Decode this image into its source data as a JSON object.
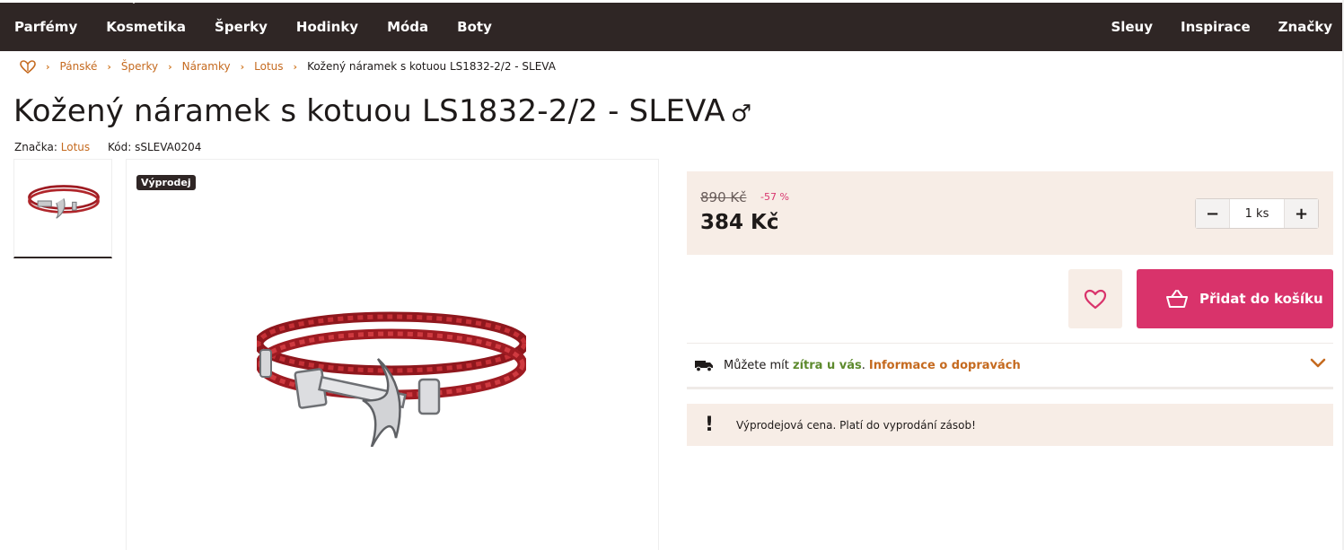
{
  "nav": {
    "left": [
      "Parfémy",
      "Kosmetika",
      "Šperky",
      "Hodinky",
      "Móda",
      "Boty"
    ],
    "right": [
      "Sleuy",
      "Inspirace",
      "Značky"
    ]
  },
  "breadcrumb": {
    "home_icon": "heart-logo-icon",
    "items": [
      "Pánské",
      "Šperky",
      "Náramky",
      "Lotus"
    ],
    "current": "Kožený náramek s kotuou LS1832-2/2 - SLEVA"
  },
  "product": {
    "title": "Kožený náramek s kotuou LS1832-2/2 - SLEVA",
    "gender_symbol": "♂",
    "brand_label": "Značka:",
    "brand": "Lotus",
    "code_label": "Kód:",
    "code": "sSLEVA0204",
    "badge": "Výprodej"
  },
  "pricing": {
    "old_price": "890 Kč",
    "discount": "-57 %",
    "price": "384 Kč",
    "quantity": "1 ks",
    "minus": "−",
    "plus": "+"
  },
  "actions": {
    "wishlist_icon": "heart-icon",
    "add_to_cart": "Přidat do košíku",
    "cart_icon": "basket-icon"
  },
  "delivery": {
    "icon": "truck-icon",
    "prefix": "Můžete mít",
    "highlight": "zítra u vás",
    "dot": ".",
    "link": "Informace o dopravách",
    "chevron_icon": "chevron-down-icon"
  },
  "notice": {
    "icon": "exclamation-icon",
    "symbol": "!",
    "text": "Výprodejová cena. Platí do vyprodání zásob!"
  },
  "colors": {
    "nav_bg": "#2f2625",
    "accent": "#d9336b",
    "link": "#c56a1f",
    "soft_bg": "#f7ede6",
    "green": "#5d8a2d"
  }
}
